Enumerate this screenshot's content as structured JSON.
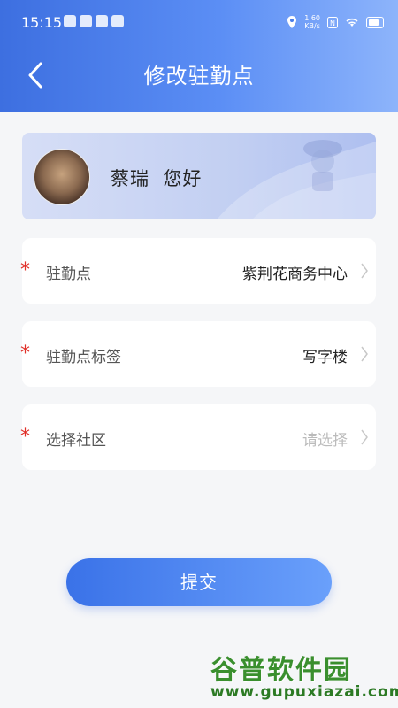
{
  "status_bar": {
    "time": "15:15",
    "network_speed_value": "1.60",
    "network_speed_unit": "KB/s"
  },
  "header": {
    "title": "修改驻勤点"
  },
  "profile": {
    "name": "蔡瑞",
    "greeting": "您好"
  },
  "form": {
    "rows": [
      {
        "label": "驻勤点",
        "value": "紫荆花商务中心",
        "required": true
      },
      {
        "label": "驻勤点标签",
        "value": "写字楼",
        "required": true
      },
      {
        "label": "选择社区",
        "value": "请选择",
        "required": true,
        "placeholder": true
      }
    ],
    "required_mark": "*"
  },
  "submit_label": "提交",
  "watermark": {
    "main": "谷普软件园",
    "sub": "www.gupuxiazai.com"
  },
  "colors": {
    "accent": "#3d6fe0",
    "required": "#e0302a"
  }
}
